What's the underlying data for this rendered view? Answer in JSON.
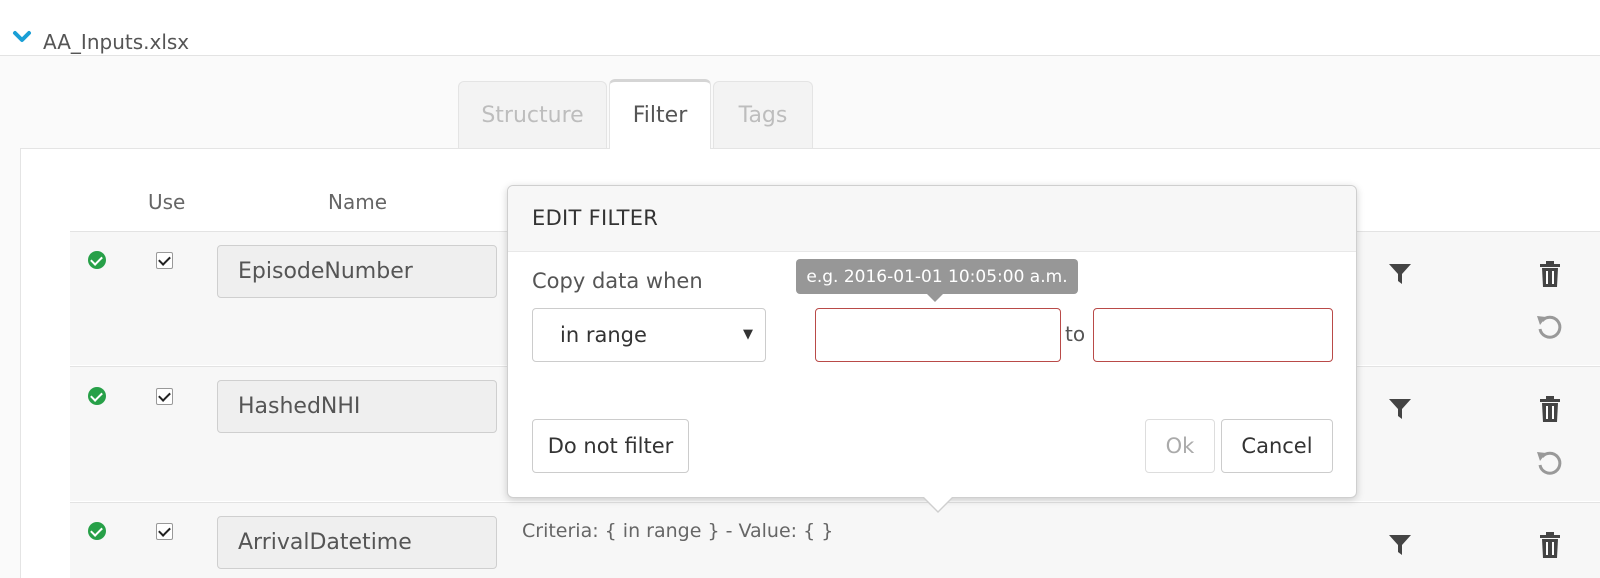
{
  "file": {
    "name": "AA_Inputs.xlsx"
  },
  "tabs": [
    {
      "label": "Structure",
      "active": false
    },
    {
      "label": "Filter",
      "active": true
    },
    {
      "label": "Tags",
      "active": false
    }
  ],
  "columns": {
    "use": "Use",
    "name": "Name"
  },
  "rows": [
    {
      "name": "EpisodeNumber",
      "checked": true,
      "status": "ok"
    },
    {
      "name": "HashedNHI",
      "checked": true,
      "status": "ok"
    },
    {
      "name": "ArrivalDatetime",
      "checked": true,
      "status": "ok",
      "criteria": "Criteria: { in range } - Value: { }"
    }
  ],
  "dialog": {
    "title": "EDIT FILTER",
    "label": "Copy data when",
    "condition": {
      "selected": "in range"
    },
    "tooltip": "e.g. 2016-01-01 10:05:00 a.m.",
    "to_label": "to",
    "from_value": "",
    "to_value": "",
    "no_filter_label": "Do not filter",
    "ok_label": "Ok",
    "cancel_label": "Cancel"
  },
  "colors": {
    "accent": "#1a9fd6",
    "status_ok": "#27a048",
    "invalid_border": "#b94a48",
    "tooltip_bg": "#979797"
  }
}
